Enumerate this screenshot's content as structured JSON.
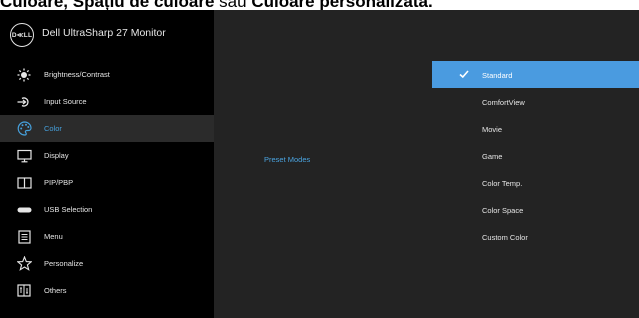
{
  "caption": {
    "part1": "Culoare, Spațiu de culoare",
    "part2": " sau ",
    "part3": "Culoare personalizată."
  },
  "osd": {
    "logo": "D≪LL",
    "title": "Dell UltraSharp 27 Monitor",
    "menu": [
      {
        "label": "Brightness/Contrast",
        "icon": "brightness-icon"
      },
      {
        "label": "Input Source",
        "icon": "input-source-icon"
      },
      {
        "label": "Color",
        "icon": "color-palette-icon",
        "active": true
      },
      {
        "label": "Display",
        "icon": "display-icon"
      },
      {
        "label": "PIP/PBP",
        "icon": "pip-pbp-icon"
      },
      {
        "label": "USB Selection",
        "icon": "usb-icon"
      },
      {
        "label": "Menu",
        "icon": "menu-icon"
      },
      {
        "label": "Personalize",
        "icon": "star-icon"
      },
      {
        "label": "Others",
        "icon": "others-icon"
      }
    ],
    "submenu_label": "Preset Modes",
    "options": [
      {
        "label": "Standard",
        "selected": true
      },
      {
        "label": "ComfortView"
      },
      {
        "label": "Movie"
      },
      {
        "label": "Game"
      },
      {
        "label": "Color Temp."
      },
      {
        "label": "Color Space"
      },
      {
        "label": "Custom Color"
      }
    ],
    "colors": {
      "selected": "#4a9be0",
      "active_text": "#46a0dc",
      "panel": "#232323",
      "sidebar": "#000000"
    }
  }
}
